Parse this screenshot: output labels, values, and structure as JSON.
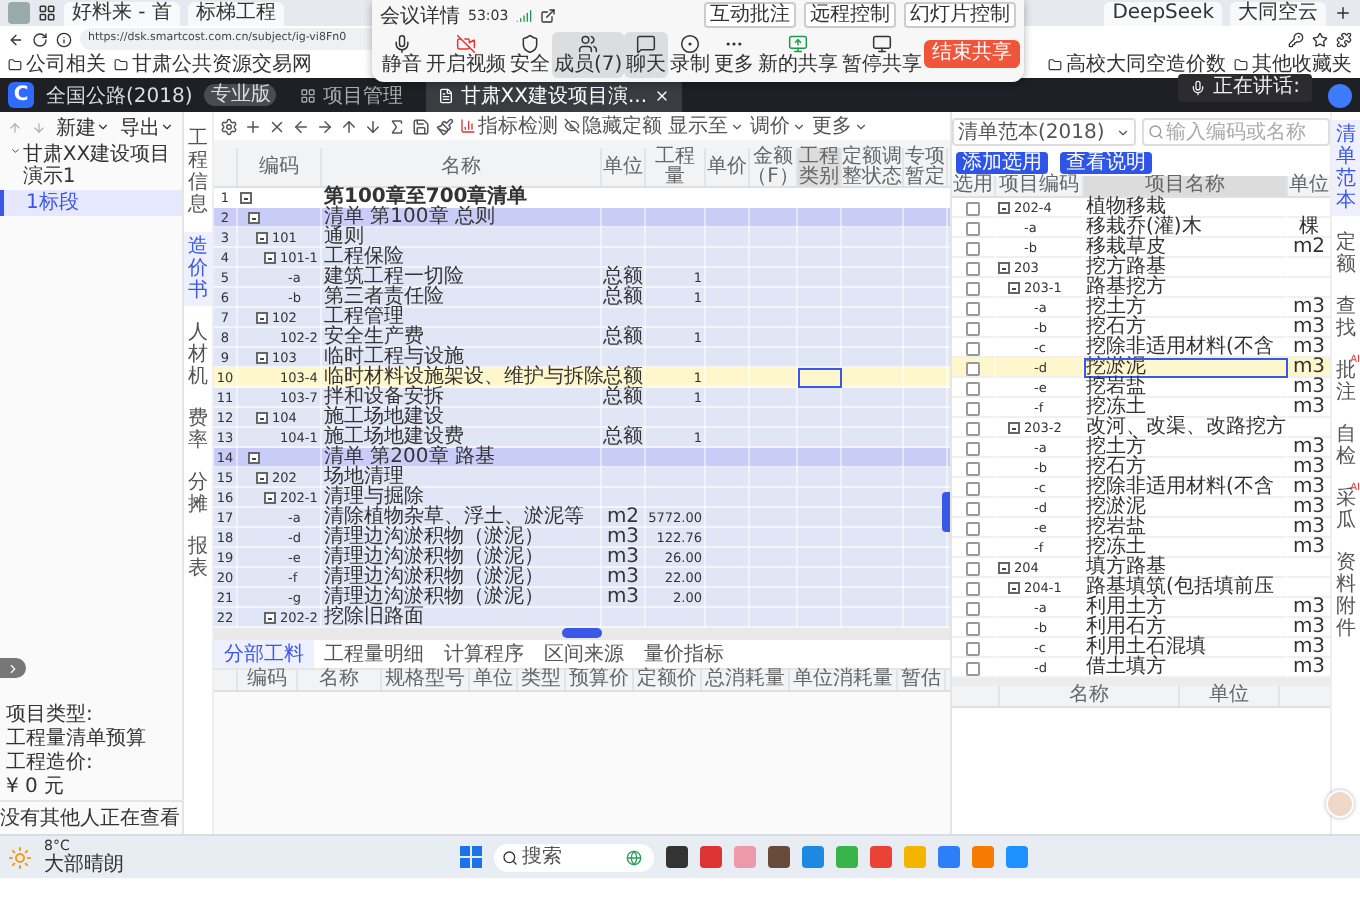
{
  "browser": {
    "tabs": [
      {
        "title": "好料来 - 首"
      },
      {
        "title": "标梯工程"
      },
      {
        "title": "DeepSeek"
      },
      {
        "title": "大同空云"
      }
    ],
    "url": "https://dsk.smartcost.com.cn/subject/ig-vi8Fn0",
    "bookmarks": [
      {
        "label": "公司相关"
      },
      {
        "label": "甘肃公共资源交易网"
      },
      {
        "label": "高校大同空造价数"
      },
      {
        "label": "其他收藏夹"
      }
    ]
  },
  "meeting": {
    "title": "会议详情",
    "timer": "53:03",
    "modes": [
      "互动批注",
      "远程控制",
      "幻灯片控制"
    ],
    "controls": [
      {
        "label": "静音",
        "kind": "mic",
        "active": false
      },
      {
        "label": "开启视频",
        "kind": "video-off",
        "active": false
      },
      {
        "label": "安全",
        "kind": "shield",
        "active": false
      },
      {
        "label": "成员(7)",
        "kind": "users",
        "active": true
      },
      {
        "label": "聊天",
        "kind": "chat",
        "active": true
      },
      {
        "label": "录制",
        "kind": "record",
        "active": false
      },
      {
        "label": "更多",
        "kind": "more",
        "active": false
      },
      {
        "label": "新的共享",
        "kind": "share",
        "active": false
      },
      {
        "label": "暂停共享",
        "kind": "pause-share",
        "active": false
      }
    ],
    "end_button": "结束共享",
    "speaking": "正在讲话:"
  },
  "app": {
    "logo": "C",
    "product": "全国公路(2018)",
    "edition": "专业版",
    "tabs": [
      {
        "label": "项目管理",
        "selected": false
      },
      {
        "label": "甘肃XX建设项目演...",
        "selected": true
      }
    ]
  },
  "left_panel": {
    "toolbar": [
      "新建",
      "导出"
    ],
    "tree": [
      {
        "label": "甘肃XX建设项目演示1",
        "expanded": true,
        "selected": false,
        "children": [
          {
            "label": "1标段",
            "selected": true
          }
        ]
      }
    ],
    "info": [
      "项目类型:",
      "工程量清单预算",
      "工程造价:",
      "¥ 0 元"
    ],
    "viewers": "没有其他人正在查看"
  },
  "side_nav": [
    {
      "label": "工程信息",
      "selected": false
    },
    {
      "label": "造价书",
      "selected": true
    },
    {
      "label": "人材机",
      "selected": false
    },
    {
      "label": "费率",
      "selected": false
    },
    {
      "label": "分摊",
      "selected": false
    },
    {
      "label": "报表",
      "selected": false
    }
  ],
  "toolbar": [
    {
      "label": "指标检测",
      "kind": "button"
    },
    {
      "label": "隐藏定额",
      "kind": "button"
    },
    {
      "label": "显示至",
      "kind": "dropdown"
    },
    {
      "label": "调价",
      "kind": "dropdown"
    },
    {
      "label": "更多",
      "kind": "dropdown"
    }
  ],
  "table": {
    "columns": [
      {
        "label": "编码",
        "selected": false
      },
      {
        "label": "名称",
        "selected": false
      },
      {
        "label": "单位",
        "selected": false
      },
      {
        "label": "工程量",
        "selected": false
      },
      {
        "label": "单价",
        "selected": false
      },
      {
        "label": "金额（F）",
        "selected": false
      },
      {
        "label": "工程类别",
        "selected": true
      },
      {
        "label": "定额调整状态",
        "selected": false
      },
      {
        "label": "专项暂定",
        "selected": false
      }
    ],
    "rows": [
      {
        "no": "1",
        "name": "第100章至700章清单",
        "kind": "root",
        "expanded": true,
        "selected": false,
        "children": [
          {
            "no": "2",
            "name": "清单 第100章 总则",
            "kind": "chapter",
            "expanded": true,
            "selected": false,
            "children": [
              {
                "no": "3",
                "code": "101",
                "name": "通则",
                "kind": "item",
                "expanded": true,
                "selected": false,
                "children": [
                  {
                    "no": "4",
                    "code": "101-1",
                    "name": "工程保险",
                    "kind": "item",
                    "expanded": true,
                    "selected": false,
                    "children": [
                      {
                        "no": "5",
                        "code": "-a",
                        "name": "建筑工程一切险",
                        "unit": "总额",
                        "qty": "1",
                        "kind": "item",
                        "selected": false
                      },
                      {
                        "no": "6",
                        "code": "-b",
                        "name": "第三者责任险",
                        "unit": "总额",
                        "qty": "1",
                        "kind": "item",
                        "selected": false
                      }
                    ]
                  }
                ]
              },
              {
                "no": "7",
                "code": "102",
                "name": "工程管理",
                "kind": "item",
                "expanded": true,
                "selected": false,
                "children": [
                  {
                    "no": "8",
                    "code": "102-2",
                    "name": "安全生产费",
                    "unit": "总额",
                    "qty": "1",
                    "kind": "item",
                    "selected": false
                  }
                ]
              },
              {
                "no": "9",
                "code": "103",
                "name": "临时工程与设施",
                "kind": "item",
                "expanded": true,
                "selected": false,
                "children": [
                  {
                    "no": "10",
                    "code": "103-4",
                    "name": "临时材料设施架设、维护与拆除",
                    "unit": "总额",
                    "qty": "1",
                    "kind": "item",
                    "selected": true
                  },
                  {
                    "no": "11",
                    "code": "103-7",
                    "name": "拌和设备安拆",
                    "unit": "总额",
                    "qty": "1",
                    "kind": "item",
                    "selected": false
                  }
                ]
              },
              {
                "no": "12",
                "code": "104",
                "name": "施工场地建设",
                "kind": "item",
                "expanded": true,
                "selected": false,
                "children": [
                  {
                    "no": "13",
                    "code": "104-1",
                    "name": "施工场地建设费",
                    "unit": "总额",
                    "qty": "1",
                    "kind": "item",
                    "selected": false
                  }
                ]
              }
            ]
          },
          {
            "no": "14",
            "name": "清单 第200章 路基",
            "kind": "chapter",
            "expanded": true,
            "selected": false,
            "children": [
              {
                "no": "15",
                "code": "202",
                "name": "场地清理",
                "kind": "item",
                "expanded": true,
                "selected": false,
                "children": [
                  {
                    "no": "16",
                    "code": "202-1",
                    "name": "清理与掘除",
                    "kind": "item",
                    "expanded": true,
                    "selected": false,
                    "children": [
                      {
                        "no": "17",
                        "code": "-a",
                        "name": "清除植物杂草、浮土、淤泥等",
                        "unit": "m2",
                        "qty": "5772.00",
                        "kind": "item",
                        "selected": false
                      },
                      {
                        "no": "18",
                        "code": "-d",
                        "name": "清理边沟淤积物（淤泥）",
                        "unit": "m3",
                        "qty": "122.76",
                        "kind": "item",
                        "selected": false
                      },
                      {
                        "no": "19",
                        "code": "-e",
                        "name": "清理边沟淤积物（淤泥）",
                        "unit": "m3",
                        "qty": "26.00",
                        "kind": "item",
                        "selected": false
                      },
                      {
                        "no": "20",
                        "code": "-f",
                        "name": "清理边沟淤积物（淤泥）",
                        "unit": "m3",
                        "qty": "22.00",
                        "kind": "item",
                        "selected": false
                      },
                      {
                        "no": "21",
                        "code": "-g",
                        "name": "清理边沟淤积物（淤泥）",
                        "unit": "m3",
                        "qty": "2.00",
                        "kind": "item",
                        "selected": false
                      }
                    ]
                  },
                  {
                    "no": "22",
                    "code": "202-2",
                    "name": "挖除旧路面",
                    "kind": "item",
                    "expanded": true,
                    "selected": false
                  }
                ]
              }
            ]
          }
        ]
      }
    ]
  },
  "bottom_panel": {
    "tabs": [
      {
        "label": "分部工料",
        "selected": true
      },
      {
        "label": "工程量明细",
        "selected": false
      },
      {
        "label": "计算程序",
        "selected": false
      },
      {
        "label": "区间来源",
        "selected": false
      },
      {
        "label": "量价指标",
        "selected": false
      }
    ],
    "columns": [
      "编码",
      "名称",
      "规格型号",
      "单位",
      "类型",
      "预算价",
      "定额价",
      "总消耗量",
      "单位消耗量",
      "暂估"
    ]
  },
  "right_panel": {
    "library": "清单范本(2018)",
    "search": {
      "placeholder": "输入编码或名称"
    },
    "buttons": [
      "添加选用",
      "查看说明"
    ],
    "columns": [
      {
        "label": "选用",
        "selected": false
      },
      {
        "label": "项目编码",
        "selected": false
      },
      {
        "label": "项目名称",
        "selected": true
      },
      {
        "label": "单位",
        "selected": false
      }
    ],
    "rows": [
      {
        "code": "202-4",
        "name": "植物移栽",
        "checked": false,
        "selected": false,
        "expanded": true,
        "children": [
          {
            "code": "-a",
            "name": "移栽乔(灌)木",
            "unit": "棵",
            "checked": false,
            "selected": false
          },
          {
            "code": "-b",
            "name": "移栽草皮",
            "unit": "m2",
            "checked": false,
            "selected": false
          }
        ]
      },
      {
        "code": "203",
        "name": "挖方路基",
        "checked": false,
        "selected": false,
        "expanded": true,
        "children": [
          {
            "code": "203-1",
            "name": "路基挖方",
            "checked": false,
            "selected": false,
            "expanded": true,
            "children": [
              {
                "code": "-a",
                "name": "挖土方",
                "unit": "m3",
                "checked": false,
                "selected": false
              },
              {
                "code": "-b",
                "name": "挖石方",
                "unit": "m3",
                "checked": false,
                "selected": false
              },
              {
                "code": "-c",
                "name": "挖除非适用材料(不含",
                "unit": "m3",
                "checked": false,
                "selected": false
              },
              {
                "code": "-d",
                "name": "挖淤泥",
                "unit": "m3",
                "checked": false,
                "selected": true
              },
              {
                "code": "-e",
                "name": "挖岩盐",
                "unit": "m3",
                "checked": false,
                "selected": false
              },
              {
                "code": "-f",
                "name": "挖冻土",
                "unit": "m3",
                "checked": false,
                "selected": false
              }
            ]
          },
          {
            "code": "203-2",
            "name": "改河、改渠、改路挖方",
            "checked": false,
            "selected": false,
            "expanded": true,
            "children": [
              {
                "code": "-a",
                "name": "挖土方",
                "unit": "m3",
                "checked": false,
                "selected": false
              },
              {
                "code": "-b",
                "name": "挖石方",
                "unit": "m3",
                "checked": false,
                "selected": false
              },
              {
                "code": "-c",
                "name": "挖除非适用材料(不含",
                "unit": "m3",
                "checked": false,
                "selected": false
              },
              {
                "code": "-d",
                "name": "挖淤泥",
                "unit": "m3",
                "checked": false,
                "selected": false
              },
              {
                "code": "-e",
                "name": "挖岩盐",
                "unit": "m3",
                "checked": false,
                "selected": false
              },
              {
                "code": "-f",
                "name": "挖冻土",
                "unit": "m3",
                "checked": false,
                "selected": false
              }
            ]
          }
        ]
      },
      {
        "code": "204",
        "name": "填方路基",
        "checked": false,
        "selected": false,
        "expanded": true,
        "children": [
          {
            "code": "204-1",
            "name": "路基填筑(包括填前压",
            "checked": false,
            "selected": false,
            "expanded": true,
            "children": [
              {
                "code": "-a",
                "name": "利用土方",
                "unit": "m3",
                "checked": false,
                "selected": false
              },
              {
                "code": "-b",
                "name": "利用石方",
                "unit": "m3",
                "checked": false,
                "selected": false
              },
              {
                "code": "-c",
                "name": "利用土石混填",
                "unit": "m3",
                "checked": false,
                "selected": false
              },
              {
                "code": "-d",
                "name": "借土填方",
                "unit": "m3",
                "checked": false,
                "selected": false
              }
            ]
          }
        ]
      }
    ],
    "bottom_columns": [
      "名称",
      "单位"
    ]
  },
  "right_nav": [
    {
      "label": "清单范本",
      "selected": true
    },
    {
      "label": "定额",
      "selected": false
    },
    {
      "label": "查找",
      "selected": false
    },
    {
      "label": "批注",
      "badge": "AI",
      "selected": false
    },
    {
      "label": "自检",
      "selected": false
    },
    {
      "label": "采瓜",
      "badge": "AI",
      "selected": false
    },
    {
      "label": "资料附件",
      "selected": false
    }
  ],
  "taskbar": {
    "temperature": "8°C",
    "weather": "大部晴朗",
    "search": {
      "placeholder": "搜索"
    }
  }
}
